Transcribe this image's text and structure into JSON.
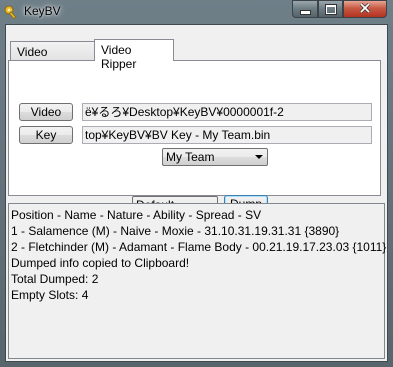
{
  "window": {
    "title": "KeyBV"
  },
  "tabs": [
    {
      "label": "Video Breaker",
      "active": false
    },
    {
      "label": "Video Ripper",
      "active": true
    }
  ],
  "ripper": {
    "video_button": "Video",
    "video_path": "ё¥るろ¥Desktop¥KeyBV¥0000001f-2",
    "key_button": "Key",
    "key_path": "top¥KeyBV¥BV Key - My Team.bin",
    "team_select": "My Team",
    "format_select": "Default",
    "dump_button": "Dump"
  },
  "output": {
    "lines": [
      "Position - Name - Nature - Ability - Spread - SV",
      "1 - Salamence (M) - Naive - Moxie - 31.10.31.19.31.31 {3890}",
      "2 - Fletchinder (M) - Adamant - Flame Body - 00.21.19.17.23.03 {1011}",
      "Dumped info copied to Clipboard!",
      "Total Dumped: 2",
      "Empty Slots: 4"
    ]
  },
  "icons": {
    "app": "key-icon",
    "minimize": "minimize-icon",
    "maximize": "maximize-icon",
    "close": "close-icon"
  },
  "colors": {
    "close_button": "#c75a45",
    "frame": "#6f7f88",
    "focus_border": "#3c7fb1"
  }
}
